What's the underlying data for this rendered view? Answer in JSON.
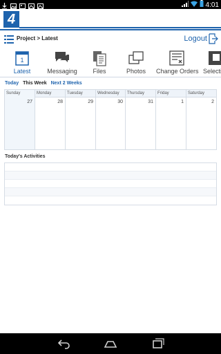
{
  "statusbar": {
    "time": "4:01"
  },
  "header": {
    "breadcrumb": "Project > Latest",
    "logout_label": "Logout"
  },
  "tabs": [
    {
      "label": "Latest",
      "active": true,
      "icon": "calendar-icon",
      "badge": "1"
    },
    {
      "label": "Messaging",
      "icon": "chat-icon"
    },
    {
      "label": "Files",
      "icon": "files-icon"
    },
    {
      "label": "Photos",
      "icon": "photos-icon"
    },
    {
      "label": "Change Orders",
      "icon": "change-orders-icon"
    },
    {
      "label": "Selecti",
      "icon": "selections-icon"
    }
  ],
  "range": {
    "today": "Today",
    "this_week": "This Week",
    "next_two_weeks": "Next 2 Weeks"
  },
  "calendar": {
    "days": [
      {
        "name": "Sunday",
        "num": "27"
      },
      {
        "name": "Monday",
        "num": "28"
      },
      {
        "name": "Tuesday",
        "num": "29"
      },
      {
        "name": "Wednesday",
        "num": "30"
      },
      {
        "name": "Thursday",
        "num": "31"
      },
      {
        "name": "Friday",
        "num": "1"
      },
      {
        "name": "Saturday",
        "num": "2"
      }
    ]
  },
  "activities": {
    "title": "Today's Activities"
  },
  "colors": {
    "accent": "#1e63ad",
    "border": "#d5dce5"
  }
}
